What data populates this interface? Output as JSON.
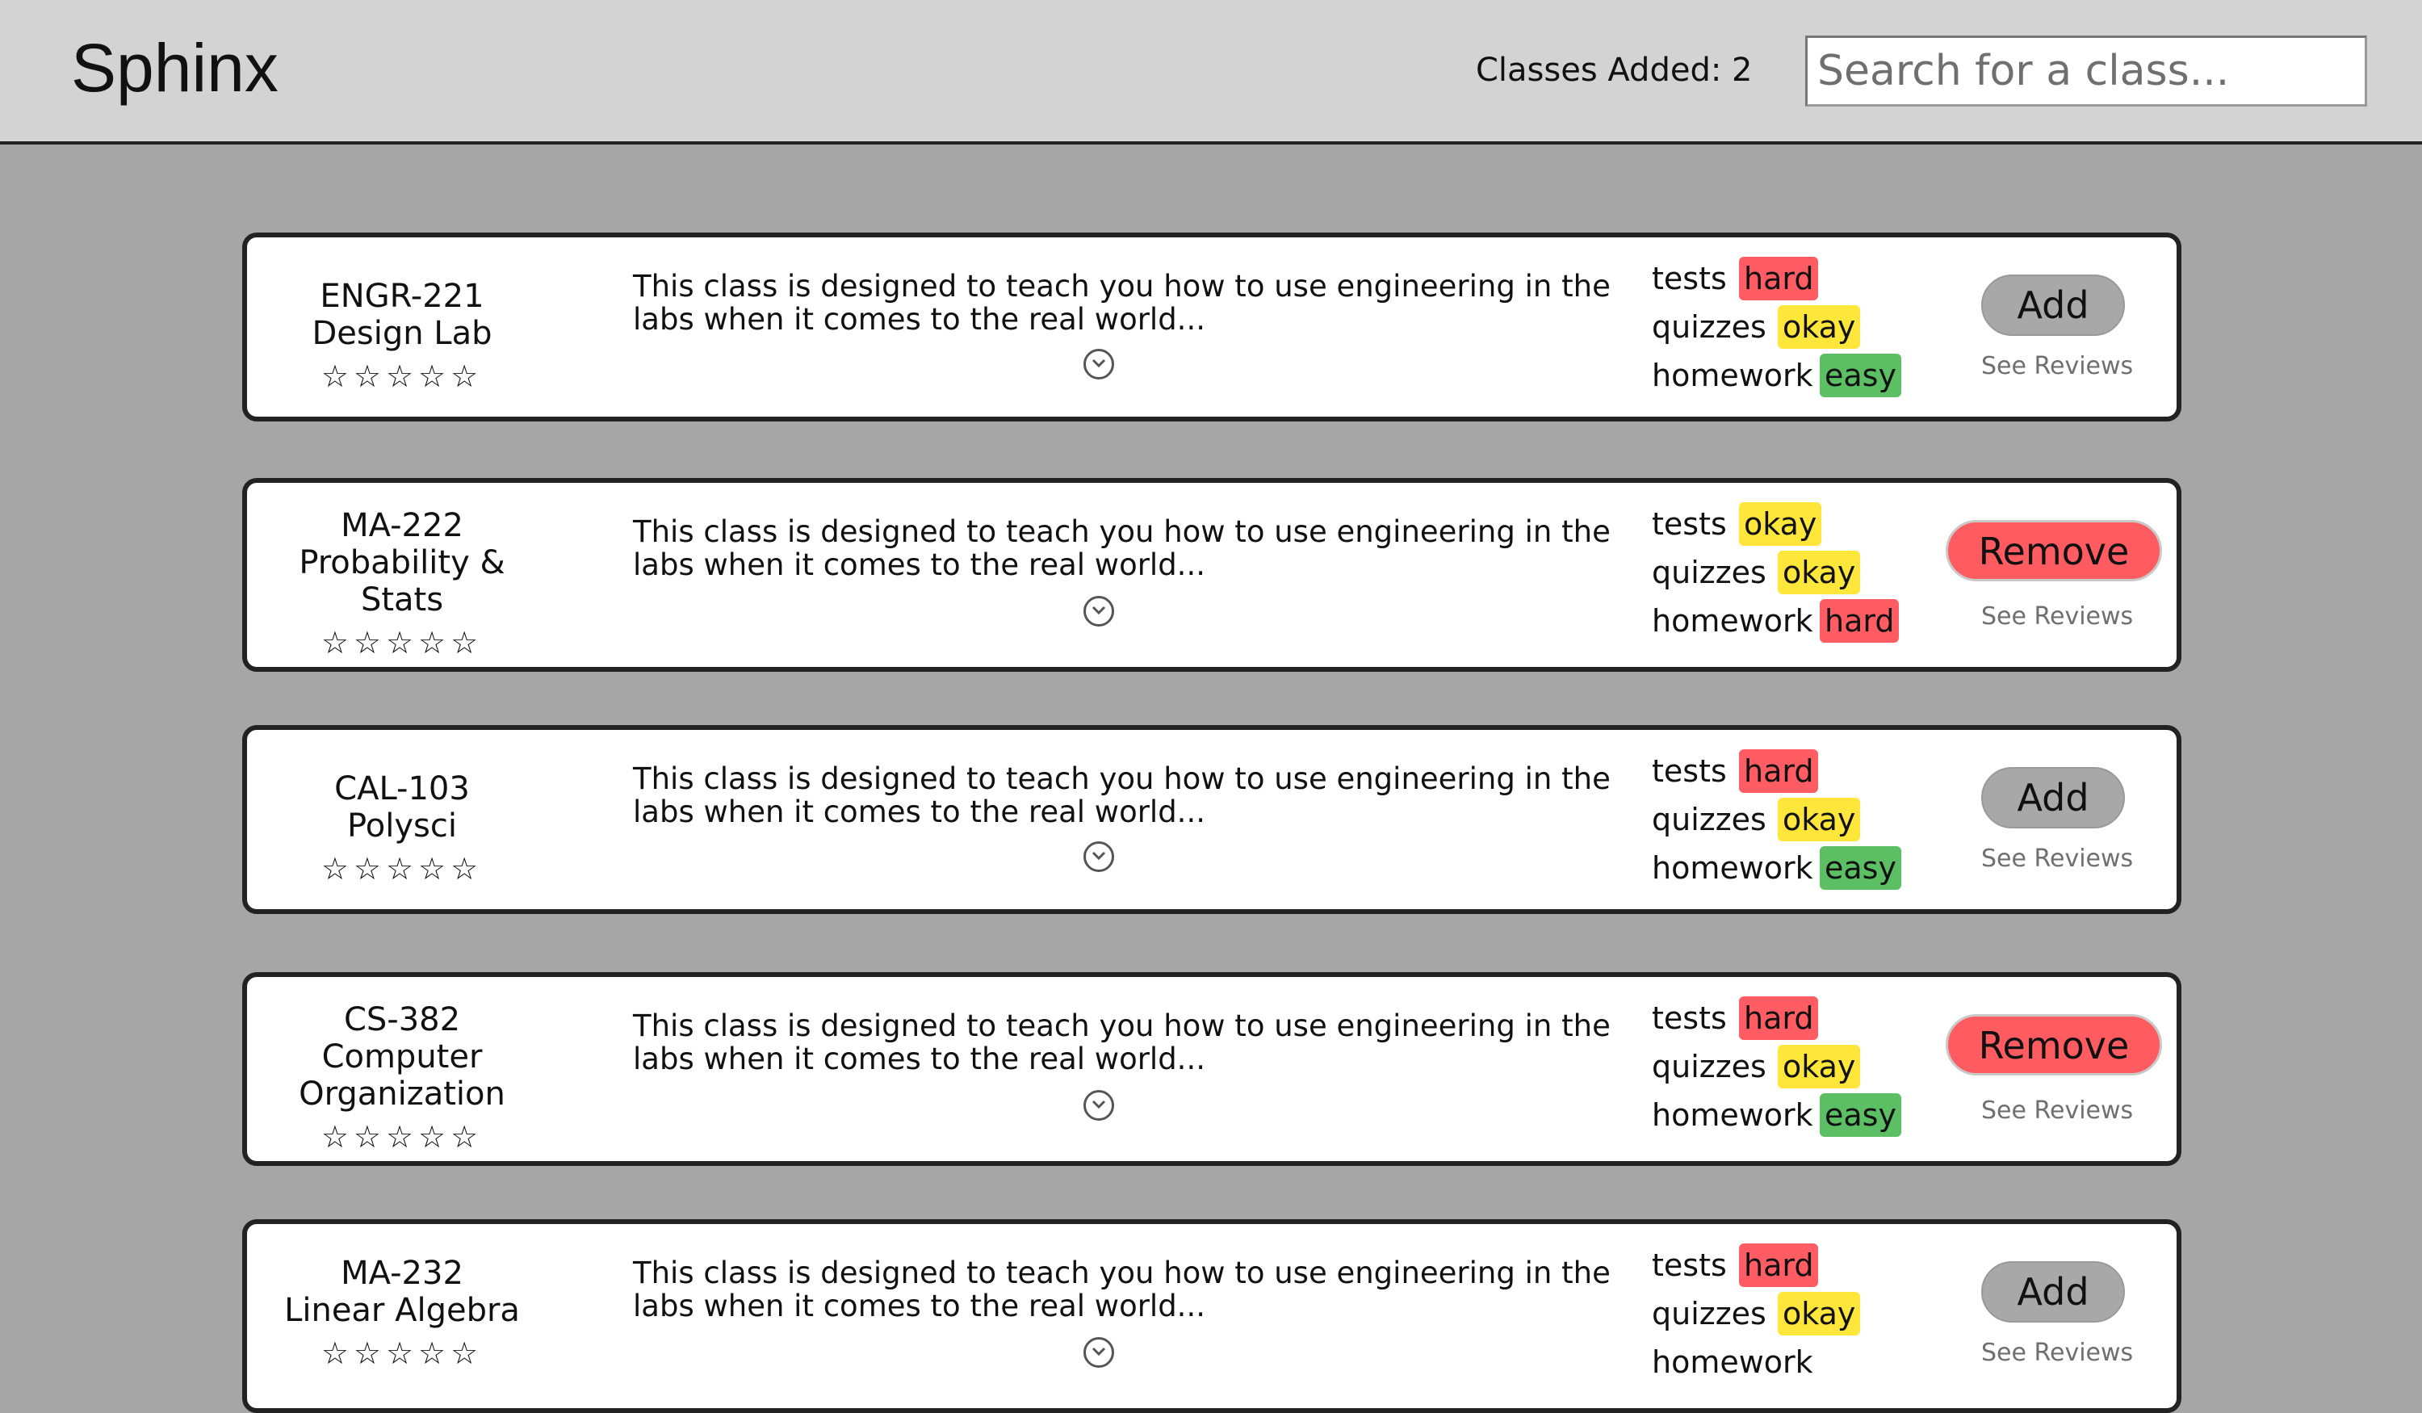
{
  "header": {
    "logo": "Sphinx",
    "classes_added": "Classes Added: 2",
    "search_placeholder": "Search for a class..."
  },
  "labels": {
    "tests": "tests",
    "quizzes": "quizzes",
    "homework": "homework",
    "see_reviews": "See Reviews",
    "stars": "☆☆☆☆☆"
  },
  "classes": [
    {
      "code": "ENGR-221",
      "name_lines": [
        "Design Lab"
      ],
      "description": "This class is designed to teach you how to use engineering in the labs when it comes to the real world...",
      "tests": "hard",
      "quizzes": "okay",
      "homework": "easy",
      "action": "Add",
      "rating": 0
    },
    {
      "code": "MA-222",
      "name_lines": [
        "Probability &",
        "Stats"
      ],
      "description": "This class is designed to teach you how to use engineering in the labs when it comes to the real world...",
      "tests": "okay",
      "quizzes": "okay",
      "homework": "hard",
      "action": "Remove",
      "rating": 0
    },
    {
      "code": "CAL-103",
      "name_lines": [
        "Polysci"
      ],
      "description": "This class is designed to teach you how to use engineering in the labs when it comes to the real world...",
      "tests": "hard",
      "quizzes": "okay",
      "homework": "easy",
      "action": "Add",
      "rating": 0
    },
    {
      "code": "CS-382",
      "name_lines": [
        "Computer",
        "Organization"
      ],
      "description": "This class is designed to teach you how to use engineering in the labs when it comes to the real world...",
      "tests": "hard",
      "quizzes": "okay",
      "homework": "easy",
      "action": "Remove",
      "rating": 0
    },
    {
      "code": "MA-232",
      "name_lines": [
        "Linear Algebra"
      ],
      "description": "This class is designed to teach you how to use engineering in the labs when it comes to the real world...",
      "tests": "hard",
      "quizzes": "okay",
      "homework": "",
      "action": "Add",
      "rating": 0
    }
  ],
  "colors": {
    "hard": "#ff5d63",
    "okay": "#ffe63a",
    "easy": "#5cbf63",
    "add_button": "#a8a8a8",
    "remove_button": "#ff5b60"
  }
}
